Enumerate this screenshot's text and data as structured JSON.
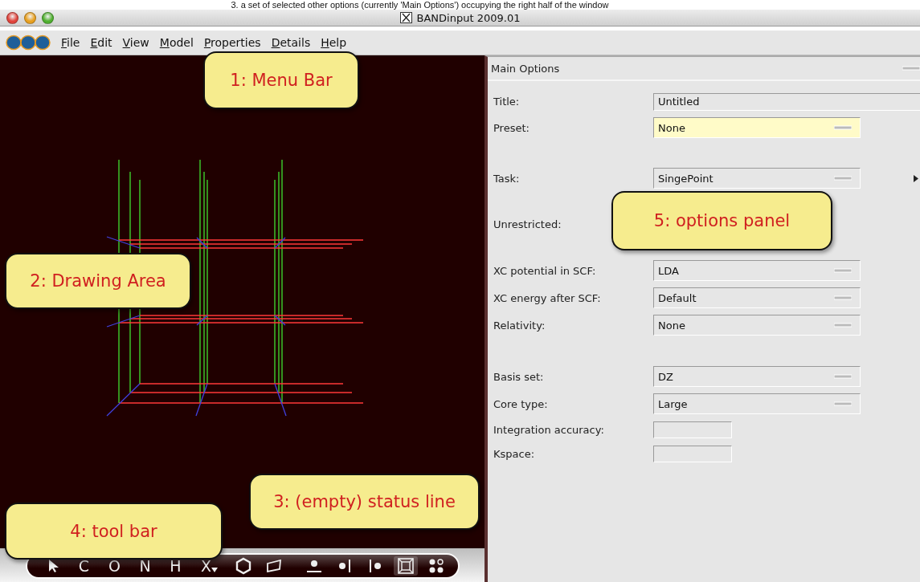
{
  "caption": "3.   a set of selected other options (currently 'Main Options') occupying the right half of the window",
  "window": {
    "title": "BANDinput 2009.01"
  },
  "menu": [
    "File",
    "Edit",
    "View",
    "Model",
    "Properties",
    "Details",
    "Help"
  ],
  "toolbar": {
    "tools": [
      {
        "kind": "icon"
      },
      {
        "kind": "letter",
        "label": "C"
      },
      {
        "kind": "letter",
        "label": "O"
      },
      {
        "kind": "letter",
        "label": "N"
      },
      {
        "kind": "letter",
        "label": "H"
      },
      {
        "kind": "menu",
        "label": "X"
      },
      {
        "kind": "icon"
      },
      {
        "kind": "icon"
      },
      {
        "kind": "gap"
      },
      {
        "kind": "icon"
      },
      {
        "kind": "icon"
      },
      {
        "kind": "icon"
      },
      {
        "kind": "icon",
        "selected": true
      },
      {
        "kind": "icon"
      }
    ]
  },
  "panel": {
    "title": "Main Options",
    "rows": [
      {
        "kind": "text",
        "label": "Title:",
        "value": "Untitled"
      },
      {
        "kind": "select",
        "label": "Preset:",
        "value": "None",
        "highlighted": true
      },
      {
        "kind": "spacer"
      },
      {
        "kind": "select",
        "label": "Task:",
        "value": "SingePoint",
        "highlighted": false,
        "more": true
      },
      {
        "kind": "label",
        "label": "Unrestricted:"
      },
      {
        "kind": "select",
        "label": "XC potential in SCF:",
        "value": "LDA",
        "highlighted": false
      },
      {
        "kind": "select",
        "label": "XC energy after SCF:",
        "value": "Default",
        "highlighted": false
      },
      {
        "kind": "select",
        "label": "Relativity:",
        "value": "None",
        "highlighted": false
      },
      {
        "kind": "spacer"
      },
      {
        "kind": "select",
        "label": "Basis set:",
        "value": "DZ",
        "highlighted": false
      },
      {
        "kind": "select",
        "label": "Core type:",
        "value": "Large",
        "highlighted": false
      },
      {
        "kind": "small",
        "label": "Integration accuracy:"
      },
      {
        "kind": "small",
        "label": "Kspace:"
      }
    ]
  },
  "callouts": [
    {
      "text": "1: Menu Bar"
    },
    {
      "text": "2: Drawing Area"
    },
    {
      "text": "3: (empty) status line"
    },
    {
      "text": "4: tool bar"
    },
    {
      "text": "5: options panel"
    }
  ]
}
